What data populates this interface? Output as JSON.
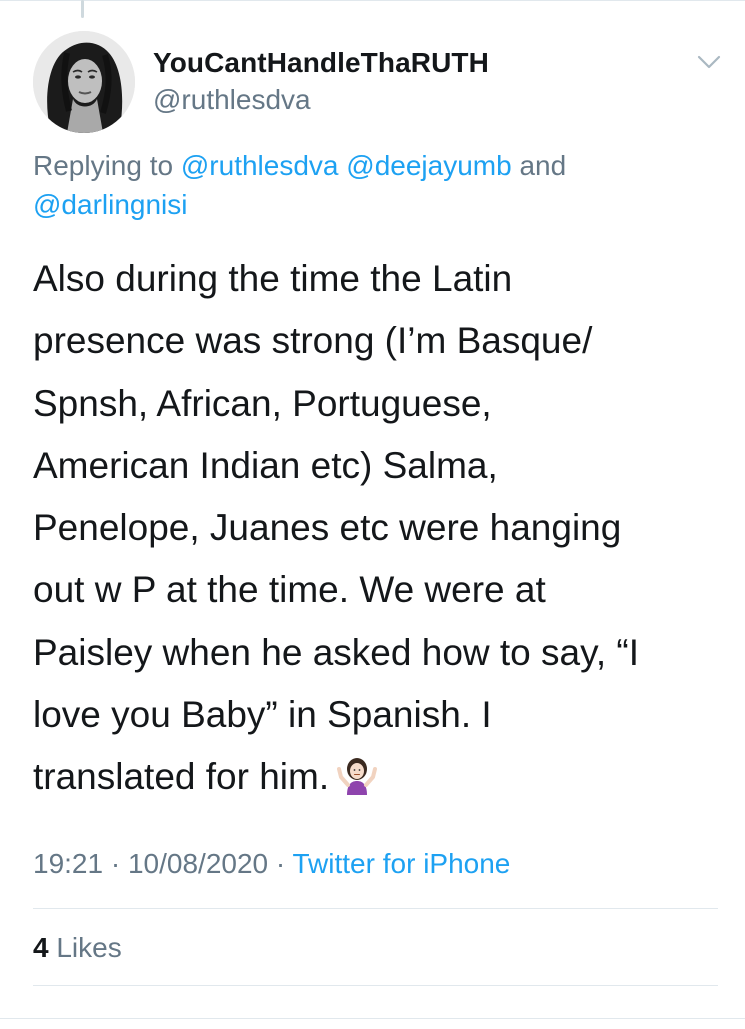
{
  "tweet": {
    "display_name": "YouCantHandleThaRUTH",
    "handle": "@ruthlesdva",
    "replying_prefix": "Replying to ",
    "replying_mentions": [
      "@ruthlesdva",
      "@deejayumb"
    ],
    "replying_and": " and ",
    "replying_last": "@darlingnisi",
    "text": "Also during the time the Latin\npresence was strong (I’m Basque/\nSpnsh, African, Portuguese,\nAmerican Indian etc) Salma,\nPenelope, Juanes etc were hanging\nout w P at the time. We were at\nPaisley when he asked how to say, “I\nlove you Baby” in Spanish. I\ntranslated for him.",
    "emoji": "woman-shrugging-emoji",
    "time": "19:21",
    "separator": " · ",
    "date": "10/08/2020",
    "source": "Twitter for iPhone",
    "likes_count": "4",
    "likes_label": " Likes"
  },
  "colors": {
    "text": "#14171a",
    "secondary": "#657786",
    "link": "#1da1f2",
    "divider": "#e1e8ed"
  },
  "icons": {
    "more": "chevron-down-icon"
  }
}
